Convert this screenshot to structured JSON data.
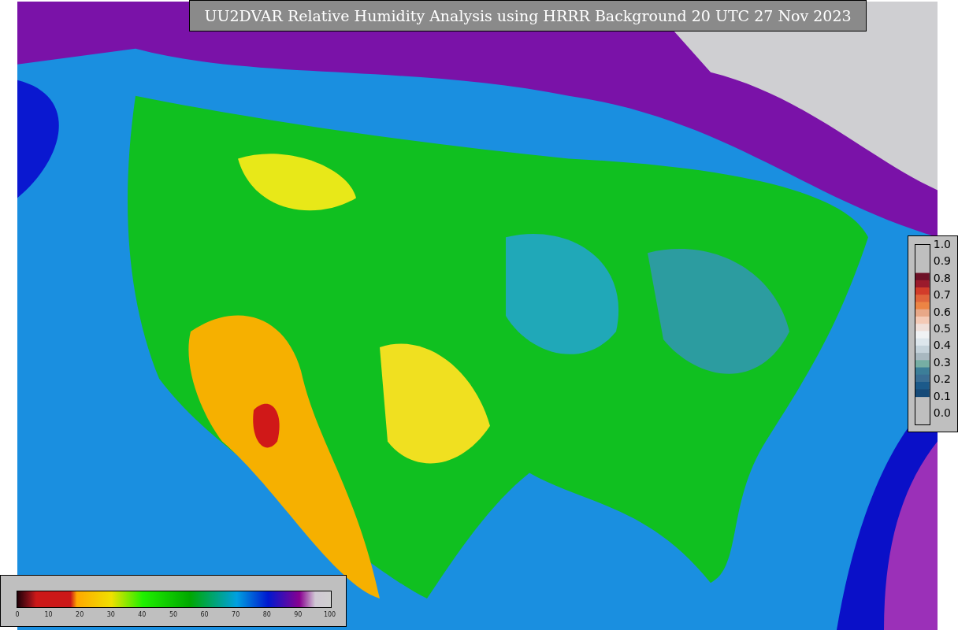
{
  "title": "UU2DVAR Relative Humidity Analysis using HRRR Background 20 UTC 27 Nov 2023",
  "humidity_colorbar": {
    "ticks": [
      "0",
      "10",
      "20",
      "30",
      "40",
      "50",
      "60",
      "70",
      "80",
      "90",
      "100"
    ]
  },
  "ratio_colorbar": {
    "ticks": [
      "1.0",
      "0.9",
      "0.8",
      "0.7",
      "0.6",
      "0.5",
      "0.4",
      "0.3",
      "0.2",
      "0.1",
      "0.0"
    ]
  }
}
